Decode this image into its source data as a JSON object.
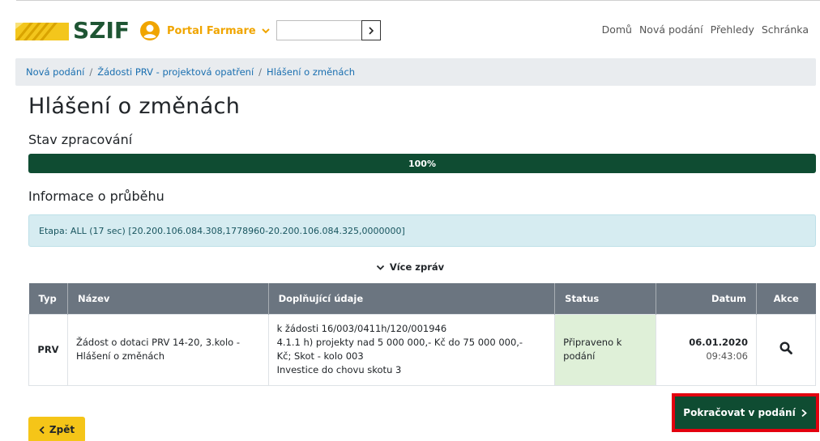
{
  "header": {
    "logo_text": "SZIF",
    "portal_label": "Portal Farmare",
    "search": {
      "value": "",
      "placeholder": ""
    },
    "nav": [
      "Domů",
      "Nová podání",
      "Přehledy",
      "Schránka"
    ]
  },
  "breadcrumb": [
    "Nová podání",
    "Žádosti PRV - projektová opatření",
    "Hlášení o změnách"
  ],
  "page_title": "Hlášení o změnách",
  "processing": {
    "title": "Stav zpracování",
    "progress_percent": 100,
    "progress_label": "100%"
  },
  "progress_info": {
    "title": "Informace o průběhu",
    "message": "Etapa: ALL (17 sec) [20.200.106.084.308,1778960-20.200.106.084.325,0000000]",
    "more_label": "Více zpráv"
  },
  "table": {
    "headers": [
      "Typ",
      "Název",
      "Doplňující údaje",
      "Status",
      "Datum",
      "Akce"
    ],
    "rows": [
      {
        "typ": "PRV",
        "nazev": [
          "Žádost o dotaci PRV 14-20, 3.kolo -",
          "Hlášení o změnách"
        ],
        "doplnujici": [
          "k žádosti 16/003/0411h/120/001946",
          "4.1.1 h) projekty nad 5 000 000,- Kč do 75 000 000,-",
          "Kč; Skot - kolo 003",
          "Investice do chovu skotu 3"
        ],
        "status": [
          "Připraveno k",
          "podání"
        ],
        "datum": "06.01.2020",
        "cas": "09:43:06"
      }
    ]
  },
  "actions": {
    "continue_label": "Pokračovat v podání",
    "back_label": "Zpět"
  },
  "colors": {
    "brand_green": "#0f4c32",
    "accent_yellow": "#f5c518",
    "highlight_red": "#e3000f"
  }
}
